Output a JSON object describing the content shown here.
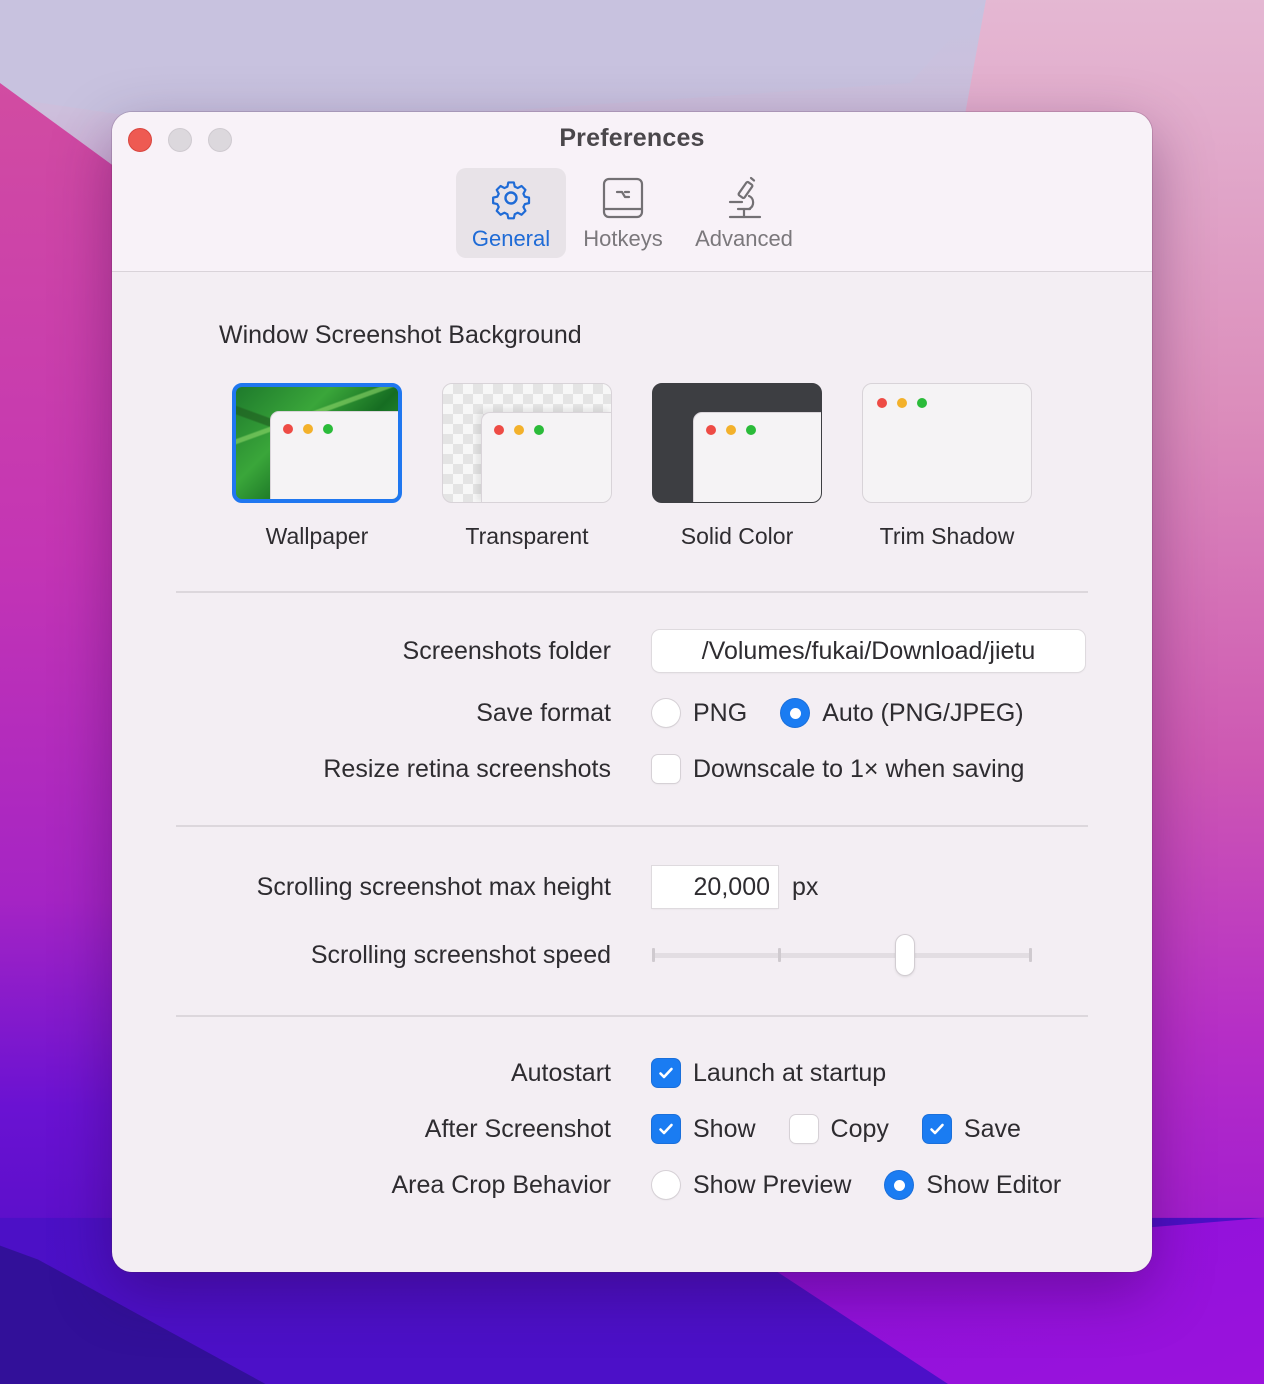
{
  "window": {
    "title": "Preferences",
    "traffic_lights": [
      "close",
      "minimize",
      "zoom"
    ]
  },
  "toolbar": {
    "tabs": [
      {
        "label": "General",
        "icon": "gear-icon",
        "active": true
      },
      {
        "label": "Hotkeys",
        "icon": "keyboard-option-key-icon",
        "active": false
      },
      {
        "label": "Advanced",
        "icon": "microscope-icon",
        "active": false
      }
    ],
    "accent_color": "#1f6bd6"
  },
  "background_section": {
    "title": "Window Screenshot Background",
    "options": [
      {
        "label": "Wallpaper",
        "selected": true
      },
      {
        "label": "Transparent",
        "selected": false
      },
      {
        "label": "Solid Color",
        "selected": false
      },
      {
        "label": "Trim Shadow",
        "selected": false
      }
    ]
  },
  "files": {
    "folder_label": "Screenshots folder",
    "folder_value": "/Volumes/fukai/Download/jietu",
    "format_label": "Save format",
    "format_options": [
      {
        "label": "PNG",
        "selected": false
      },
      {
        "label": "Auto (PNG/JPEG)",
        "selected": true
      }
    ],
    "resize_label": "Resize retina screenshots",
    "resize_option": {
      "label": "Downscale to 1× when saving",
      "checked": false
    }
  },
  "scrolling": {
    "max_height_label": "Scrolling screenshot max height",
    "max_height_value": "20,000",
    "max_height_unit": "px",
    "speed_label": "Scrolling screenshot speed",
    "speed_ticks": 4,
    "speed_value_fraction": 0.667
  },
  "behavior": {
    "autostart_label": "Autostart",
    "autostart_option": {
      "label": "Launch at startup",
      "checked": true
    },
    "after_label": "After Screenshot",
    "after_options": [
      {
        "label": "Show",
        "checked": true
      },
      {
        "label": "Copy",
        "checked": false
      },
      {
        "label": "Save",
        "checked": true
      }
    ],
    "crop_label": "Area Crop Behavior",
    "crop_options": [
      {
        "label": "Show Preview",
        "selected": false
      },
      {
        "label": "Show Editor",
        "selected": true
      }
    ]
  },
  "colors": {
    "checkbox_on": "#1a7cf2",
    "selected_border": "#1f77f0"
  }
}
